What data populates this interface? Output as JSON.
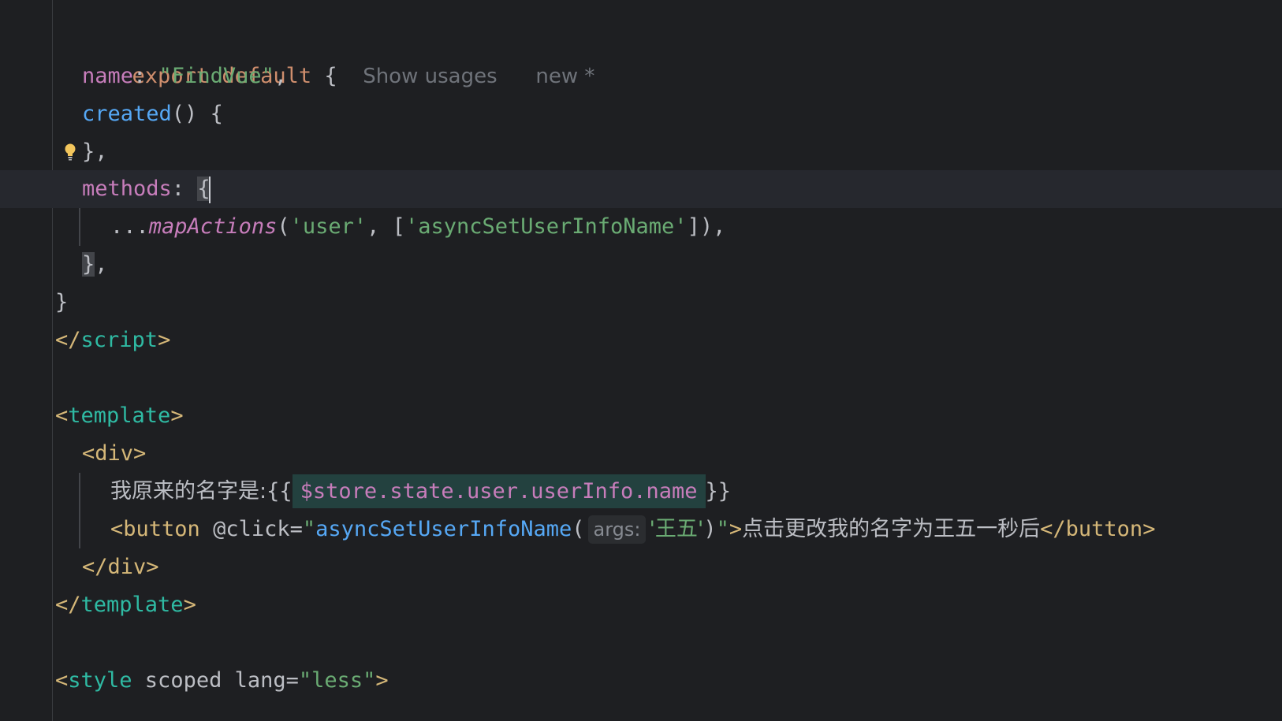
{
  "editor": {
    "lines": {
      "l1": {
        "export": "export",
        "default": "default",
        "brace": "{",
        "usages_hint": "Show usages",
        "new_hint": "new *"
      },
      "l2": {
        "key": "name",
        "colon": ": ",
        "value": "\"FindVue\"",
        "comma": ","
      },
      "l3": {
        "fn": "created",
        "rest": "() {"
      },
      "l4": {
        "text": "},"
      },
      "l5": {
        "key": "methods",
        "colon": ": ",
        "brace": "{"
      },
      "l6": {
        "spread": "...",
        "fn": "mapActions",
        "open": "(",
        "arg1": "'user'",
        "sep": ", [",
        "arg2": "'asyncSetUserInfoName'",
        "close": "]),"
      },
      "l7": {
        "brace": "}",
        "comma": ","
      },
      "l8": {
        "text": "}"
      },
      "l9": {
        "open": "</",
        "name": "script",
        "close": ">"
      },
      "l11": {
        "open": "<",
        "name": "template",
        "close": ">"
      },
      "l12": {
        "open": "<",
        "name": "div",
        "close": ">"
      },
      "l13": {
        "label": "我原来的名字是:",
        "mustache_open": "{{",
        "expr": "$store.state.user.userInfo.name",
        "mustache_close": "}}"
      },
      "l14": {
        "open": "<",
        "name": "button",
        "attr": " @click=",
        "quote_open": "\"",
        "fn": "asyncSetUserInfoName",
        "paren": "(",
        "param_hint": "args:",
        "arg": "'王五'",
        "paren_close": ")",
        "quote_close": "\"",
        "tag_end": ">",
        "text": "点击更改我的名字为王五一秒后",
        "close_open": "</",
        "close_name": "button",
        "close_end": ">"
      },
      "l15": {
        "open": "</",
        "name": "div",
        "close": ">"
      },
      "l16": {
        "open": "</",
        "name": "template",
        "close": ">"
      },
      "l18": {
        "open": "<",
        "name": "style",
        "attr1": " scoped lang=",
        "value": "\"less\"",
        "close": ">"
      }
    }
  },
  "colors": {
    "background": "#1e1f22",
    "keyword": "#cf8e6d",
    "property": "#c77dbb",
    "string": "#6aab73",
    "function": "#56a8f5",
    "tag_bracket": "#d5b778",
    "tag_name": "#2fbaa3"
  },
  "icons": {
    "intention": "lightbulb-icon"
  }
}
